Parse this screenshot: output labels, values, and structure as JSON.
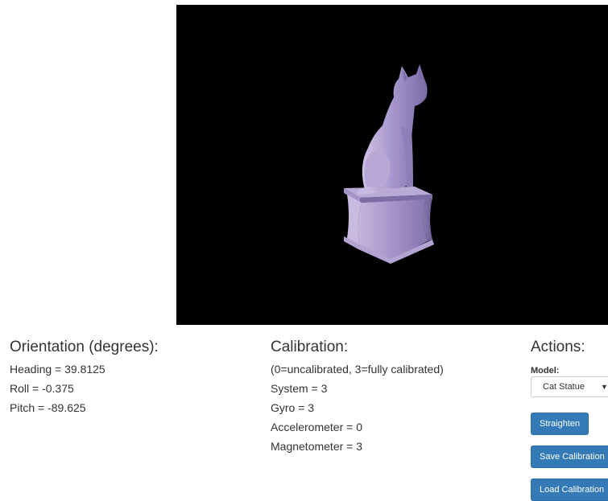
{
  "orientation": {
    "title": "Orientation (degrees):",
    "heading": "Heading = 39.8125",
    "roll": "Roll = -0.375",
    "pitch": "Pitch = -89.625"
  },
  "calibration": {
    "title": "Calibration:",
    "legend": "(0=uncalibrated, 3=fully calibrated)",
    "system": "System = 3",
    "gyro": "Gyro = 3",
    "accelerometer": "Accelerometer = 0",
    "magnetometer": "Magnetometer = 3"
  },
  "actions": {
    "title": "Actions:",
    "model_label": "Model:",
    "model_selected": "Cat Statue",
    "straighten_label": "Straighten",
    "save_label": "Save Calibration",
    "load_label": "Load Calibration"
  },
  "viewport": {
    "background": "#000000",
    "model_color": "#9d8fd0"
  },
  "colors": {
    "button": "#337ab7",
    "text": "#333333"
  }
}
